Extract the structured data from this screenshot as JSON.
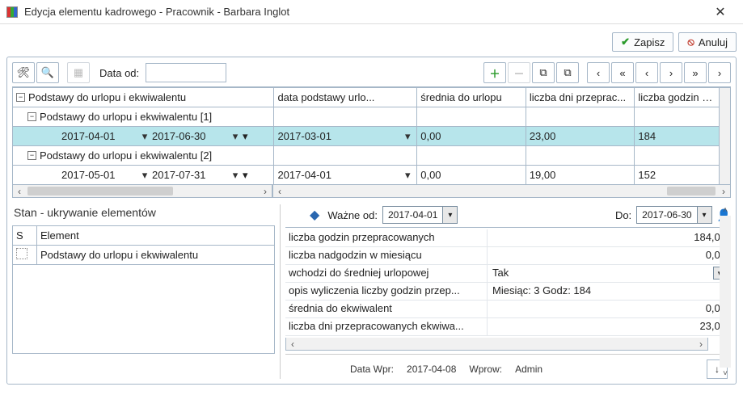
{
  "window": {
    "title": "Edycja elementu kadrowego - Pracownik - Barbara Inglot",
    "close": "✕"
  },
  "buttons": {
    "save": "Zapisz",
    "cancel": "Anuluj"
  },
  "toolbar": {
    "date_label": "Data od:",
    "date_value": "",
    "nav_first": "❘◀",
    "nav_prev2": "≪",
    "nav_prev": "‹",
    "nav_next": "›",
    "nav_next2": "≫",
    "nav_last": "▶❘"
  },
  "grid": {
    "tree_header": "",
    "cols": [
      "data podstawy urlo...",
      "średnia do urlopu",
      "liczba dni przeprac...",
      "liczba godzin prz"
    ],
    "root": "Podstawy do urlopu i ekwiwalentu",
    "groups": [
      {
        "label": "Podstawy do urlopu i ekwiwalentu [1]",
        "row": {
          "from": "2017-04-01",
          "to": "2017-06-30",
          "basis_date": "2017-03-01",
          "avg": "0,00",
          "days": "23,00",
          "hours": "184"
        },
        "selected": true
      },
      {
        "label": "Podstawy do urlopu i ekwiwalentu [2]",
        "row": {
          "from": "2017-05-01",
          "to": "2017-07-31",
          "basis_date": "2017-04-01",
          "avg": "0,00",
          "days": "19,00",
          "hours": "152"
        },
        "selected": false
      }
    ]
  },
  "state_panel": {
    "title": "Stan - ukrywanie elementów",
    "col_s": "S",
    "col_el": "Element",
    "item": "Podstawy do urlopu i ekwiwalentu"
  },
  "detail": {
    "valid_from_label": "Ważne od:",
    "valid_from": "2017-04-01",
    "valid_to_label": "Do:",
    "valid_to": "2017-06-30",
    "fields": [
      {
        "name": "liczba godzin przepracowanych",
        "value": "184,00",
        "align": "right"
      },
      {
        "name": "liczba nadgodzin w miesiącu",
        "value": "0,00",
        "align": "right"
      },
      {
        "name": "wchodzi do średniej urlopowej",
        "value": "Tak",
        "align": "left",
        "dropdown": true
      },
      {
        "name": "opis wyliczenia liczby godzin przep...",
        "value": "Miesiąc: 3 Godz: 184",
        "align": "left"
      },
      {
        "name": "średnia do ekwiwalent",
        "value": "0,00",
        "align": "right"
      },
      {
        "name": "liczba dni przepracowanych ekwiwa...",
        "value": "23,00",
        "align": "right"
      }
    ]
  },
  "footer": {
    "date_wpr_label": "Data Wpr:",
    "date_wpr": "2017-04-08",
    "wprow_label": "Wprow:",
    "wprow": "Admin",
    "down": "↓"
  }
}
